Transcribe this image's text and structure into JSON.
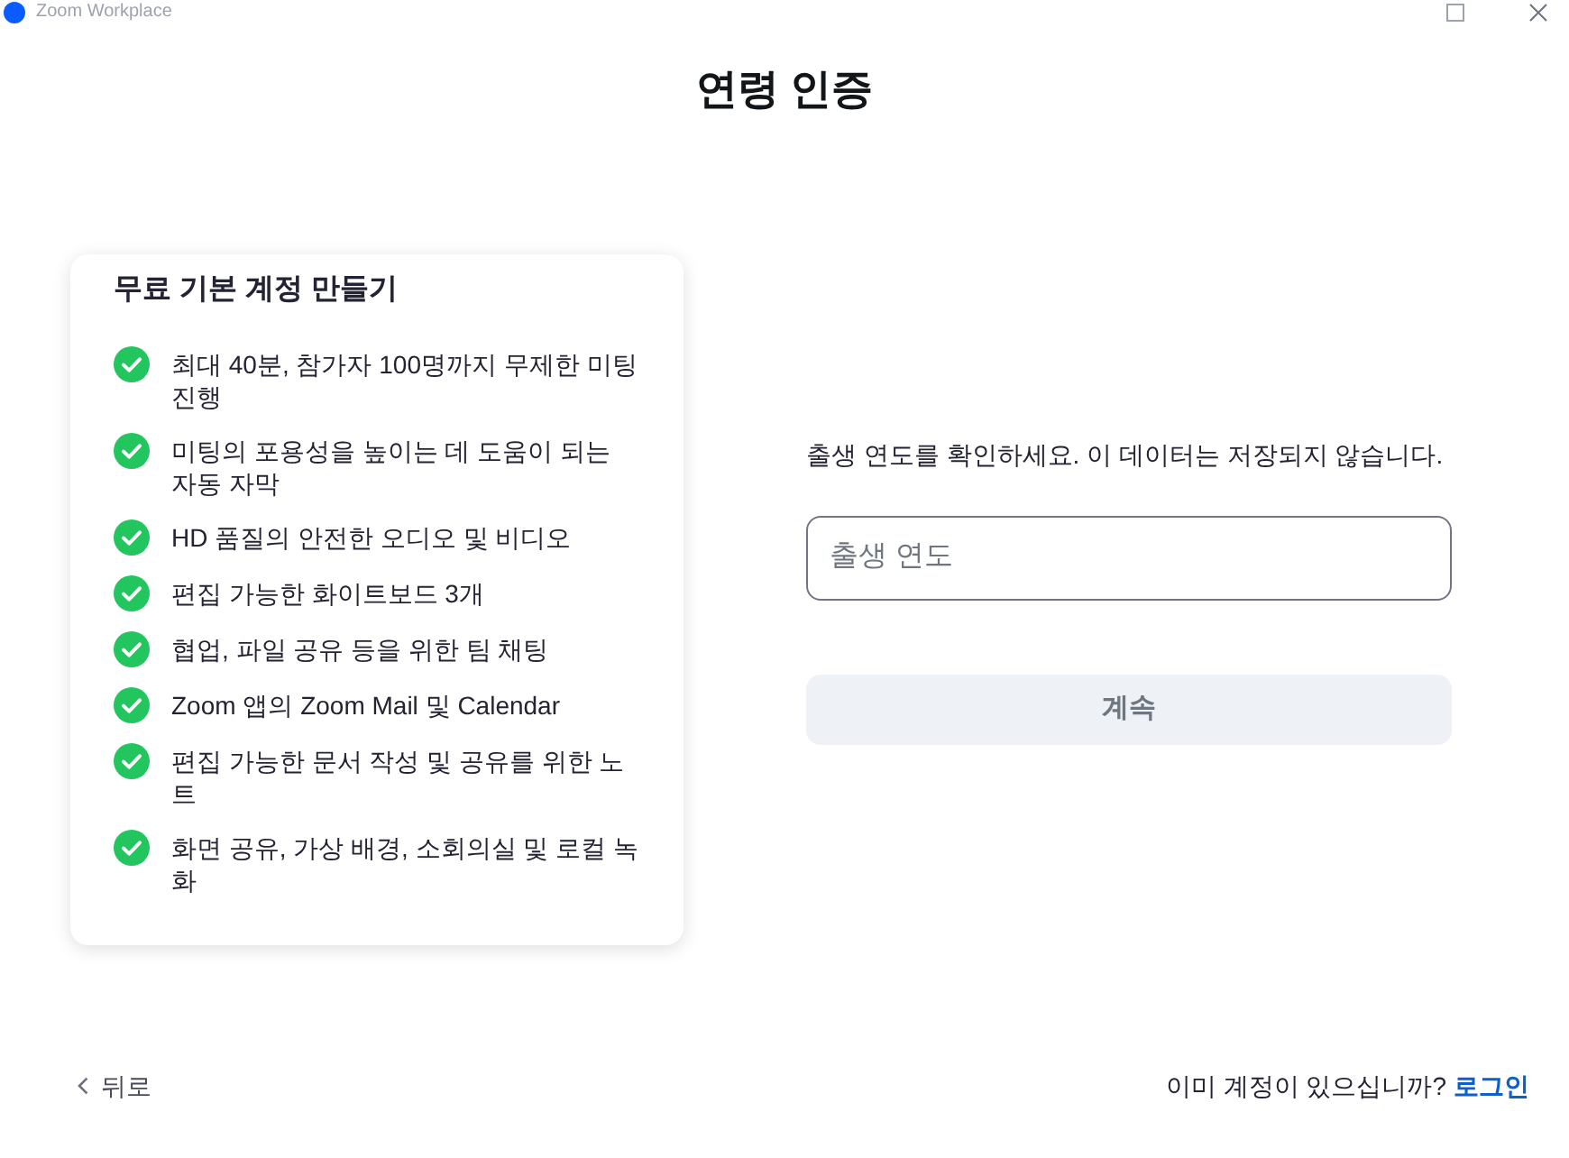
{
  "window": {
    "title": "Zoom Workplace"
  },
  "page": {
    "title": "연령 인증"
  },
  "plan_card": {
    "title": "무료 기본 계정 만들기",
    "features": [
      {
        "text": "최대 40분, 참가자 100명까지 무제한 미팅 진행",
        "checked": true
      },
      {
        "text": "미팅의 포용성을 높이는 데 도움이 되는 자동 자막",
        "checked": true
      },
      {
        "text": "HD 품질의 안전한 오디오 및 비디오",
        "checked": true
      },
      {
        "text": "편집 가능한 화이트보드 3개",
        "checked": true
      },
      {
        "text": "협업, 파일 공유 등을 위한 팀 채팅",
        "checked": true
      },
      {
        "text": "Zoom 앱의 Zoom Mail 및 Calendar",
        "checked": true
      },
      {
        "text": "편집 가능한 문서 작성 및 공유를 위한 노트",
        "checked": true
      },
      {
        "text": "화면 공유, 가상 배경, 소회의실 및 로컬 녹화",
        "checked": true
      }
    ]
  },
  "verification": {
    "instruction": "출생 연도를 확인하세요. 이 데이터는 저장되지 않습니다.",
    "birth_year_field": {
      "placeholder": "출생 연도"
    },
    "continue_button": {
      "label": "계속",
      "disabled": true
    }
  },
  "footer": {
    "back_link": "뒤로",
    "login_prompt": "이미 계정이 있으십니까?",
    "login_link": "로그인"
  }
}
